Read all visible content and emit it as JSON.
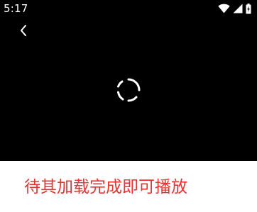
{
  "status_bar": {
    "time": "5:17",
    "icons": [
      "wifi-icon",
      "cell-signal-icon",
      "battery-charging-icon"
    ]
  },
  "player": {
    "back_icon": "chevron-left-icon",
    "loading_icon": "spinner-icon"
  },
  "message": {
    "text": "待其加载完成即可播放",
    "color": "#e8332f"
  },
  "colors": {
    "player_background": "#000000",
    "page_background": "#ffffff",
    "icon": "#ffffff"
  }
}
